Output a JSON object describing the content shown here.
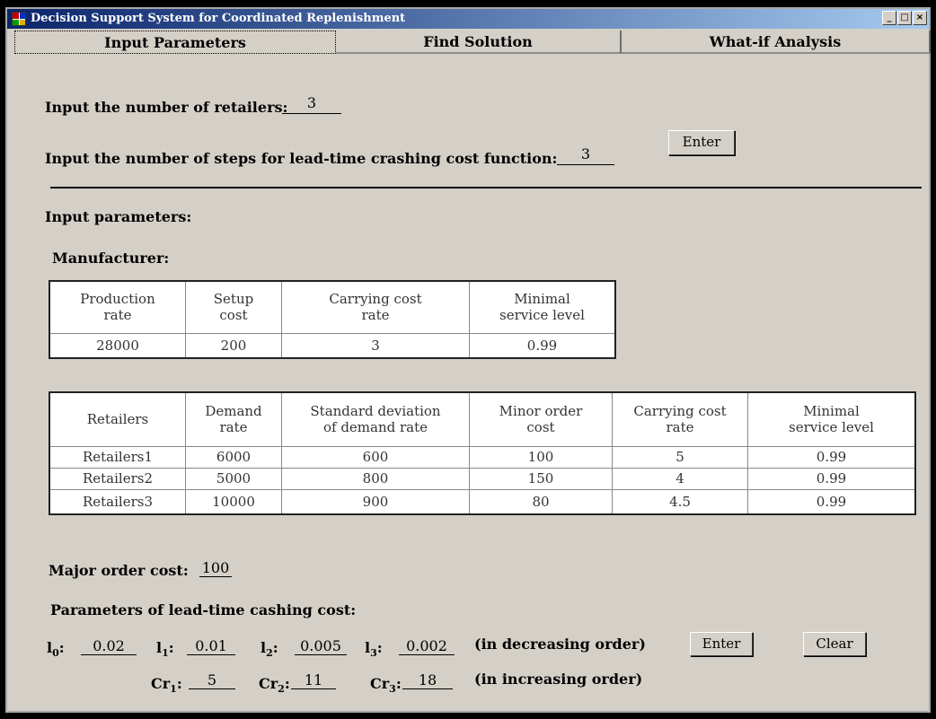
{
  "window": {
    "title": "Decision Support System for Coordinated Replenishment",
    "controls": {
      "minimize": "_",
      "maximize": "□",
      "close": "×"
    },
    "icon_colors": [
      "#c00000",
      "#0030c0",
      "#00a000",
      "#e0b000"
    ]
  },
  "tabs": [
    {
      "label": "Input Parameters",
      "active": true
    },
    {
      "label": "Find Solution",
      "active": false
    },
    {
      "label": "What-if Analysis",
      "active": false
    }
  ],
  "setup": {
    "retailers_label": "Input the number of retailers:",
    "retailers_value": "3",
    "steps_label": "Input the number of steps for lead-time crashing cost function:",
    "steps_value": "3",
    "enter_label": "Enter"
  },
  "section_title": "Input parameters:",
  "manufacturer": {
    "title": "Manufacturer:",
    "headers": [
      [
        "Production",
        "rate"
      ],
      [
        "Setup",
        "cost"
      ],
      [
        "Carrying cost",
        "rate"
      ],
      [
        "Minimal",
        "service level"
      ]
    ],
    "values": [
      "28000",
      "200",
      "3",
      "0.99"
    ]
  },
  "retailers_table": {
    "headers": [
      [
        "Retailers",
        ""
      ],
      [
        "Demand",
        "rate"
      ],
      [
        "Standard deviation",
        "of demand rate"
      ],
      [
        "Minor order",
        "cost"
      ],
      [
        "Carrying cost",
        "rate"
      ],
      [
        "Minimal",
        "service level"
      ]
    ],
    "rows": [
      [
        "Retailers1",
        "6000",
        "600",
        "100",
        "5",
        "0.99"
      ],
      [
        "Retailers2",
        "5000",
        "800",
        "150",
        "4",
        "0.99"
      ],
      [
        "Retailers3",
        "10000",
        "900",
        "80",
        "4.5",
        "0.99"
      ]
    ]
  },
  "major_order": {
    "label": "Major order cost:",
    "value": "100"
  },
  "lead_time": {
    "title": "Parameters of lead-time cashing cost:",
    "l_params": [
      {
        "key": "l",
        "sub": "0",
        "value": "0.02"
      },
      {
        "key": "l",
        "sub": "1",
        "value": "0.01"
      },
      {
        "key": "l",
        "sub": "2",
        "value": "0.005"
      },
      {
        "key": "l",
        "sub": "3",
        "value": "0.002"
      }
    ],
    "l_note": "(in decreasing order)",
    "cr_params": [
      {
        "key": "Cr",
        "sub": "1",
        "value": "5"
      },
      {
        "key": "Cr",
        "sub": "2",
        "value": "11"
      },
      {
        "key": "Cr",
        "sub": "3",
        "value": "18"
      }
    ],
    "cr_note": "(in increasing order)",
    "enter_label": "Enter",
    "clear_label": "Clear"
  }
}
